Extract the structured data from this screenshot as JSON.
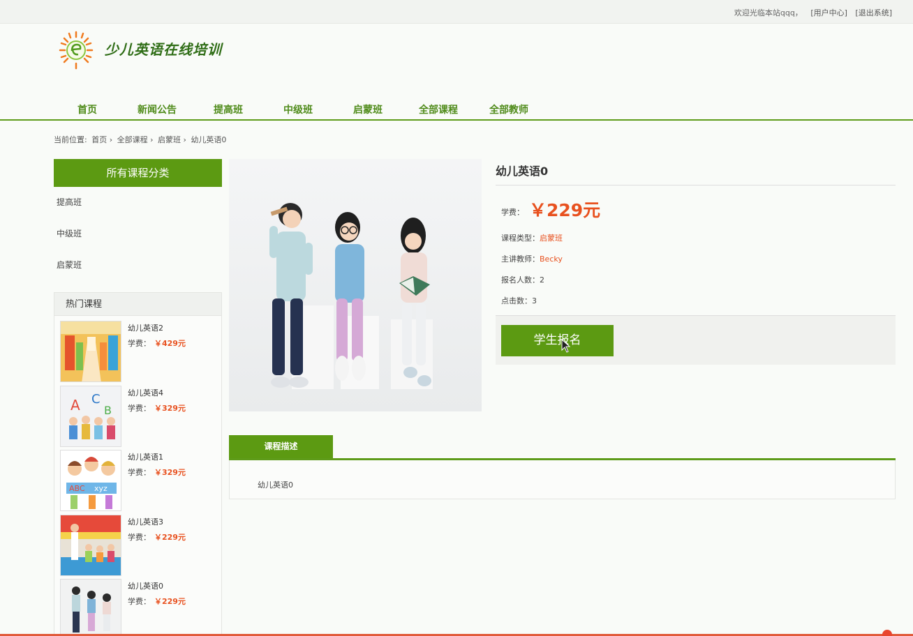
{
  "topbar": {
    "welcome": "欢迎光临本站qqq，",
    "user_center": "[用户中心]",
    "logout": "[退出系统]"
  },
  "site": {
    "title": "少儿英语在线培训"
  },
  "nav": [
    "首页",
    "新闻公告",
    "提高班",
    "中级班",
    "启蒙班",
    "全部课程",
    "全部教师"
  ],
  "breadcrumb": {
    "prefix": "当前位置:",
    "items": [
      "首页 ›",
      "全部课程 ›",
      "启蒙班 ›",
      "幼儿英语0"
    ]
  },
  "sidebar": {
    "header": "所有课程分类",
    "categories": [
      "提高班",
      "中级班",
      "启蒙班"
    ],
    "hot_header": "热门课程",
    "hot_price_label": "学费：",
    "hot_courses": [
      {
        "name": "幼儿英语2",
        "price": "￥429元"
      },
      {
        "name": "幼儿英语4",
        "price": "￥329元"
      },
      {
        "name": "幼儿英语1",
        "price": "￥329元"
      },
      {
        "name": "幼儿英语3",
        "price": "￥229元"
      },
      {
        "name": "幼儿英语0",
        "price": "￥229元"
      }
    ]
  },
  "course": {
    "title": "幼儿英语0",
    "fee_label": "学费：",
    "fee": "￥229元",
    "type_label": "课程类型：",
    "type": "启蒙班",
    "teacher_label": "主讲教师：",
    "teacher": "Becky",
    "enrolled_label": "报名人数：",
    "enrolled": "2",
    "clicks_label": "点击数：",
    "clicks": "3",
    "enroll_button": "学生报名"
  },
  "tabs": {
    "description": "课程描述"
  },
  "description": {
    "text": "幼儿英语0"
  },
  "colors": {
    "brand_green": "#5c9a12",
    "price_orange": "#e8511f"
  }
}
